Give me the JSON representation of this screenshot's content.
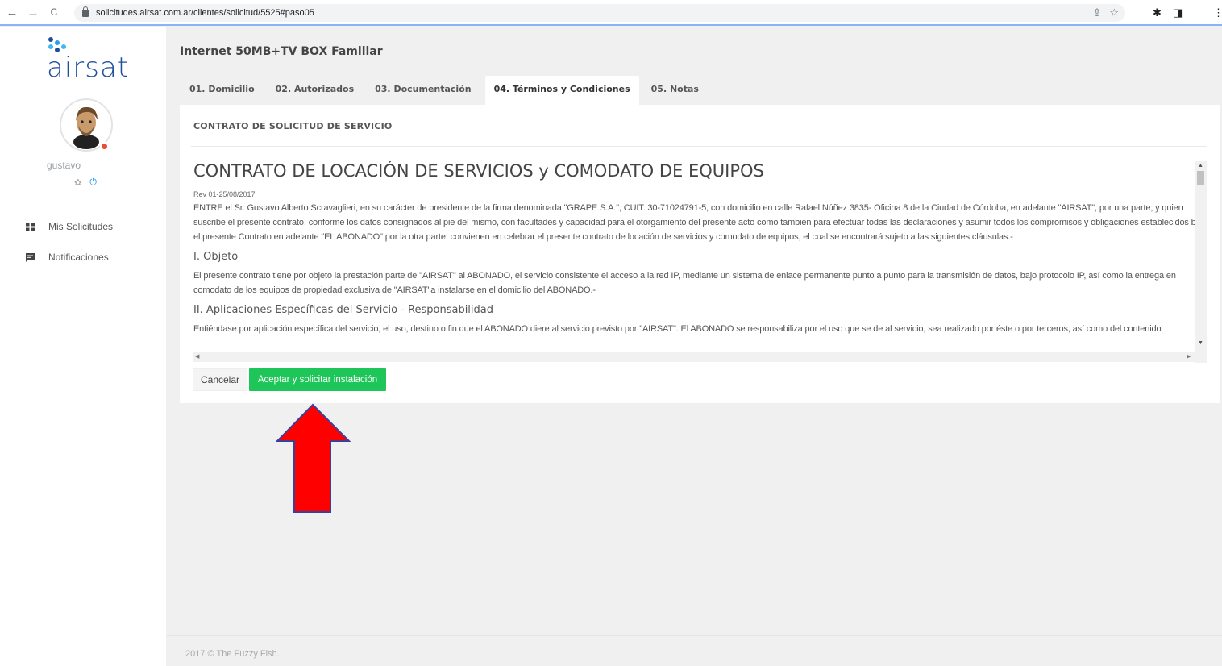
{
  "browser": {
    "url": "solicitudes.airsat.com.ar/clientes/solicitud/5525#paso05",
    "back": "←",
    "forward": "→",
    "reload": "C"
  },
  "sidebar": {
    "logo_text": "airsat",
    "username": "gustavo",
    "menu": [
      {
        "label": "Mis Solicitudes"
      },
      {
        "label": "Notificaciones"
      }
    ]
  },
  "page": {
    "title": "Internet 50MB+TV BOX Familiar",
    "tabs": [
      {
        "label": "01. Domicilio"
      },
      {
        "label": "02. Autorizados"
      },
      {
        "label": "03. Documentación"
      },
      {
        "label": "04. Términos y Condiciones",
        "active": true
      },
      {
        "label": "05. Notas"
      }
    ]
  },
  "card": {
    "title": "CONTRATO DE SOLICITUD DE SERVICIO",
    "contract_heading": "CONTRATO DE LOCACIÓN DE SERVICIOS y COMODATO DE EQUIPOS",
    "rev": "Rev 01-25/08/2017",
    "intro": "ENTRE el Sr. Gustavo Alberto Scravaglieri, en su carácter de presidente de la firma denominada \"GRAPE S.A.\", CUIT. 30-71024791-5, con domicilio en calle Rafael Núñez 3835- Oficina 8 de la Ciudad de Córdoba, en adelante \"AIRSAT\", por una parte; y quien suscribe el presente contrato, conforme los datos consignados al pie del mismo, con facultades y capacidad para el otorgamiento del presente acto como también para efectuar todas las declaraciones y asumir todos los compromisos y obligaciones establecidos bajo el presente Contrato en adelante \"EL ABONADO\" por la otra parte, convienen en celebrar el presente contrato de locación de servicios y comodato de equipos, el cual se encontrará sujeto a las siguientes cláusulas.-",
    "section1_title": "I. Objeto",
    "section1_text": "El presente contrato tiene por objeto la prestación parte de \"AIRSAT\" al ABONADO, el servicio consistente el acceso a la red IP, mediante un sistema de enlace permanente punto a punto para la transmisión de datos, bajo protocolo IP, así como la entrega en comodato de los equipos de propiedad exclusiva de \"AIRSAT\"a instalarse en el domicilio del ABONADO.-",
    "section2_title": "II. Aplicaciones Específicas del Servicio - Responsabilidad",
    "section2_text": "Entiéndase por aplicación específica del servicio, el uso, destino o fin que el ABONADO diere al servicio previsto por \"AIRSAT\". El ABONADO se responsabiliza por el uso que se de al servicio, sea realizado por éste o por terceros, así como del contenido",
    "cancel_label": "Cancelar",
    "accept_label": "Aceptar y solicitar instalación"
  },
  "footer": {
    "text": "2017 © The Fuzzy Fish."
  },
  "colors": {
    "accent_green": "#1ec659",
    "brand_blue": "#1f4f9a",
    "annotation_red": "#ff0000"
  }
}
